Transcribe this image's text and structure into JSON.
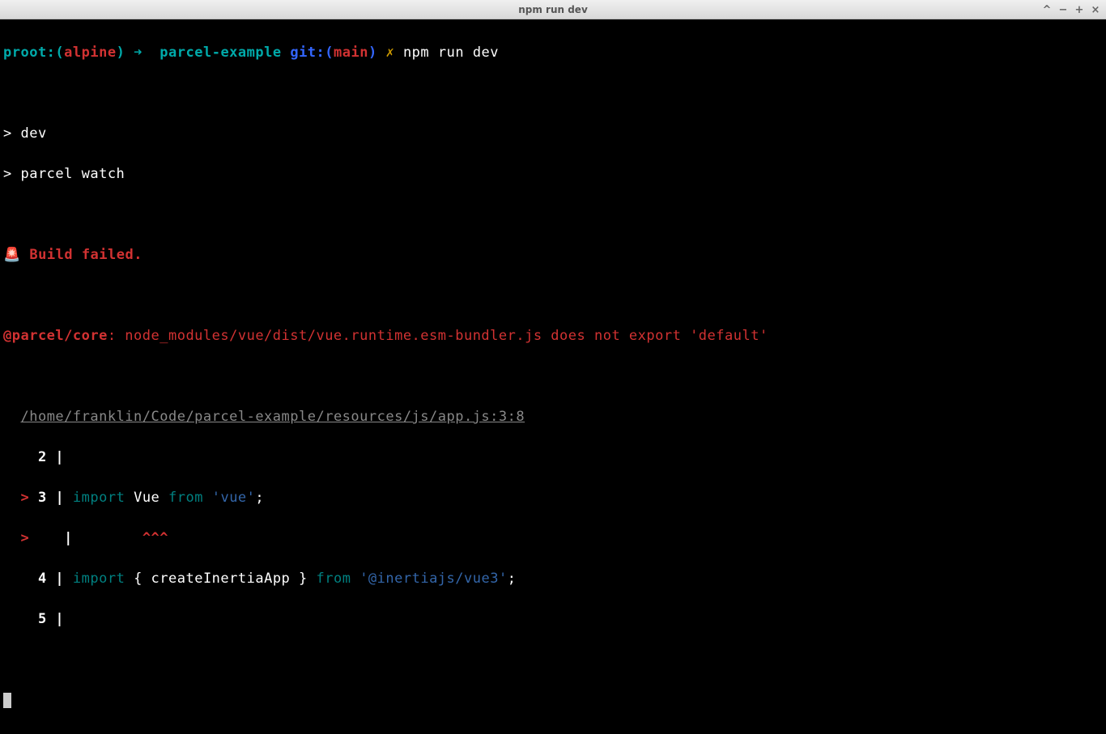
{
  "titlebar": {
    "title": "npm run dev"
  },
  "prompt": {
    "proot": "proot:",
    "open_paren": "(",
    "distro": "alpine",
    "close_paren": ")",
    "arrow": " ➜ ",
    "dir": " parcel-example",
    "git_label": " git:(",
    "branch": "main",
    "git_close": ")",
    "dirty": " ✗ ",
    "command": "npm run dev"
  },
  "output": {
    "dev": "> dev",
    "parcel_watch": "> parcel watch",
    "error_icon": "🚨 ",
    "build_failed": "Build failed.",
    "error_source": "@parcel/core",
    "error_message": ": node_modules/vue/dist/vue.runtime.esm-bundler.js does not export 'default'",
    "file_path": "/home/franklin/Code/parcel-example/resources/js/app.js:3:8",
    "line2_num": "    2",
    "pipe": " | ",
    "line3_marker": "  >",
    "line3_num": " 3",
    "line3_import": "import",
    "line3_vue": " Vue ",
    "line3_from": "from",
    "line3_str": " 'vue'",
    "line3_semi": ";",
    "caret_marker": "  >",
    "caret_spaces": "   ",
    "caret_pipe": " | ",
    "caret_pad": "       ",
    "carets": "^^^",
    "line4_num": "    4",
    "line4_import": "import",
    "line4_braces": " { createInertiaApp } ",
    "line4_from": "from",
    "line4_str": " '@inertiajs/vue3'",
    "line4_semi": ";",
    "line5_num": "    5"
  }
}
